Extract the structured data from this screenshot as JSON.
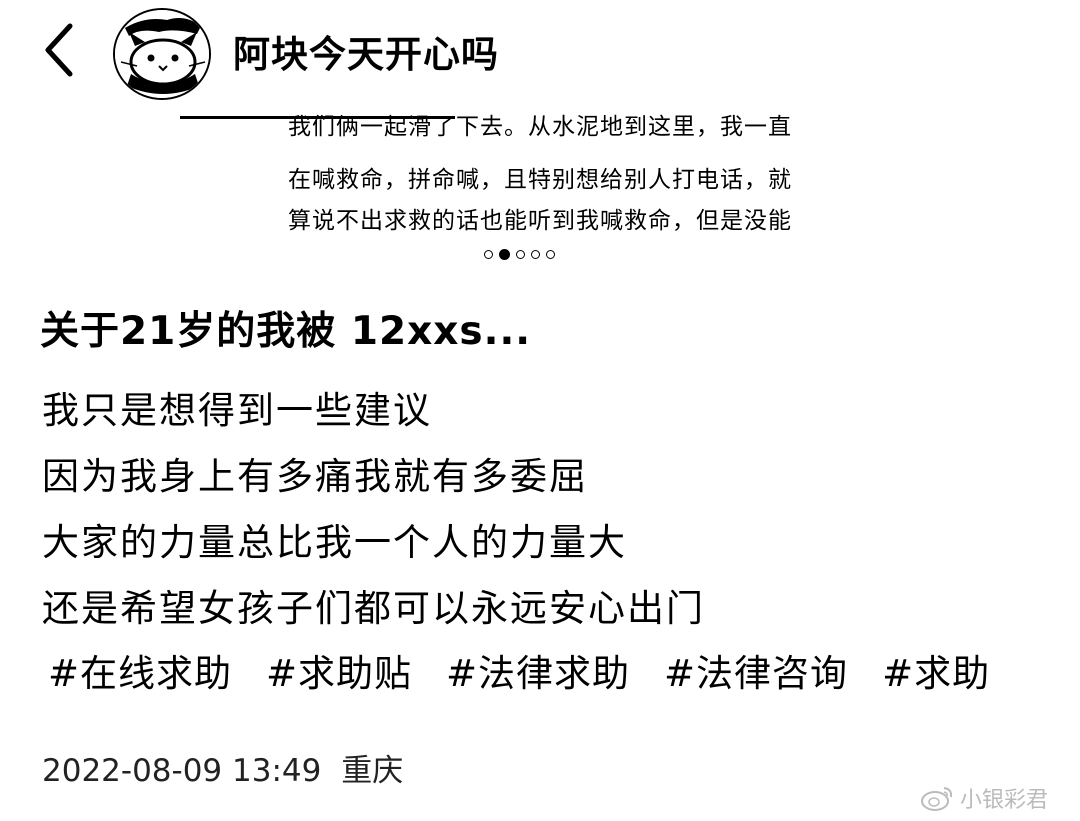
{
  "header": {
    "username": "阿块今天开心吗"
  },
  "image_slide": {
    "lines": [
      "我们俩一起滑了下去。从水泥地到这里，我一直",
      "在喊救命，拼命喊，且特别想给别人打电话，就",
      "算说不出求救的话也能听到我喊救命，但是没能"
    ],
    "page_count": 5,
    "active_page": 1
  },
  "post": {
    "title": "关于21岁的我被 12xxs...",
    "lines": [
      "我只是想得到一些建议",
      "因为我身上有多痛我就有多委屈",
      "大家的力量总比我一个人的力量大",
      "还是希望女孩子们都可以永远安心出门"
    ],
    "tags": [
      "#在线求助",
      "#求助贴",
      "#法律求助",
      "#法律咨询",
      "#求助"
    ],
    "timestamp": "2022-08-09 13:49",
    "location": "重庆"
  },
  "watermark": {
    "text": "小银彩君",
    "icon": "weibo-icon"
  }
}
